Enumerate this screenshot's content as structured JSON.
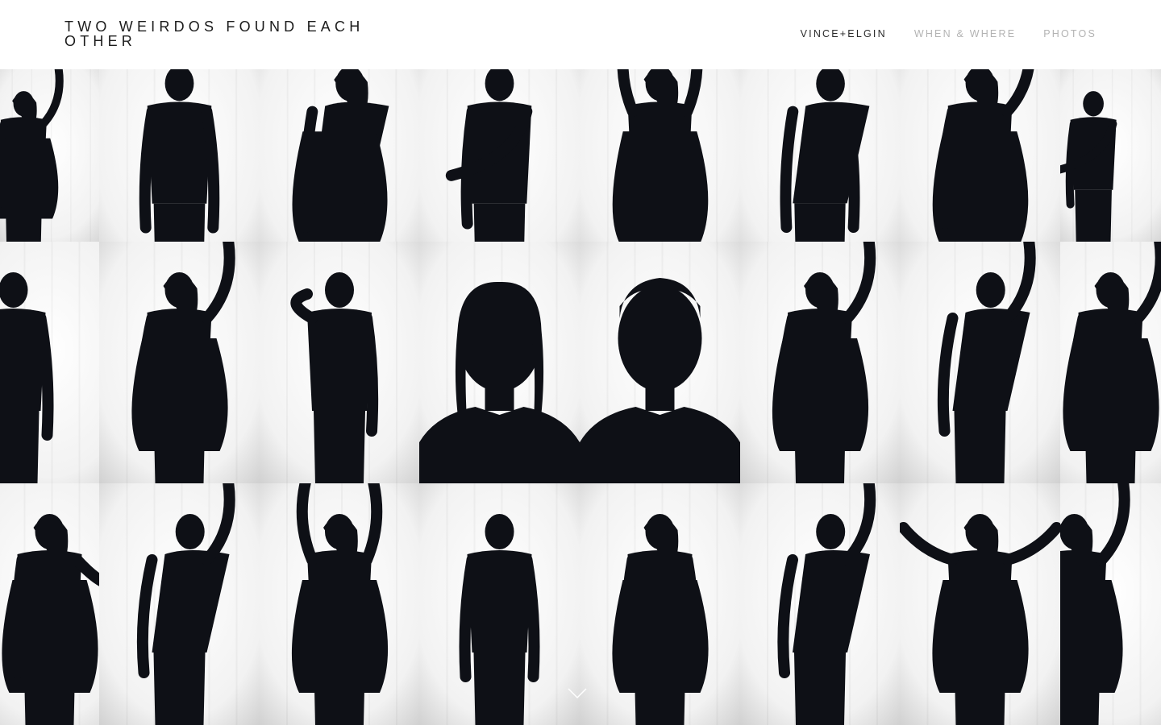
{
  "site": {
    "title": "TWO WEIRDOS FOUND EACH OTHER"
  },
  "nav": {
    "items": [
      {
        "label": "VINCE+ELGIN",
        "active": true
      },
      {
        "label": "WHEN & WHERE",
        "active": false
      },
      {
        "label": "PHOTOS",
        "active": false
      }
    ]
  },
  "gallery": {
    "rows": 3,
    "columns": 8,
    "tiles": [
      {
        "row": 1,
        "col": 1,
        "subject": "woman",
        "pose": "arm-up-turned"
      },
      {
        "row": 1,
        "col": 2,
        "subject": "man",
        "pose": "standing-head-down"
      },
      {
        "row": 1,
        "col": 3,
        "subject": "woman",
        "pose": "leaning-cardigan"
      },
      {
        "row": 1,
        "col": 4,
        "subject": "man",
        "pose": "arm-extended-profile"
      },
      {
        "row": 1,
        "col": 5,
        "subject": "woman",
        "pose": "arms-raised"
      },
      {
        "row": 1,
        "col": 6,
        "subject": "man",
        "pose": "bending-side"
      },
      {
        "row": 1,
        "col": 7,
        "subject": "woman",
        "pose": "hand-on-head"
      },
      {
        "row": 1,
        "col": 8,
        "subject": "man",
        "pose": "arm-across"
      },
      {
        "row": 2,
        "col": 1,
        "subject": "man",
        "pose": "head-down-cropped"
      },
      {
        "row": 2,
        "col": 2,
        "subject": "woman",
        "pose": "arm-up-reaching"
      },
      {
        "row": 2,
        "col": 3,
        "subject": "man",
        "pose": "hand-to-face"
      },
      {
        "row": 2,
        "col": 4,
        "subject": "woman",
        "pose": "portrait"
      },
      {
        "row": 2,
        "col": 5,
        "subject": "man",
        "pose": "portrait"
      },
      {
        "row": 2,
        "col": 6,
        "subject": "woman",
        "pose": "arm-over-head"
      },
      {
        "row": 2,
        "col": 7,
        "subject": "man",
        "pose": "leaning-arm-up"
      },
      {
        "row": 2,
        "col": 8,
        "subject": "woman",
        "pose": "cardigan-over-head"
      },
      {
        "row": 3,
        "col": 1,
        "subject": "woman",
        "pose": "hand-raised"
      },
      {
        "row": 3,
        "col": 2,
        "subject": "man",
        "pose": "arm-up-bending"
      },
      {
        "row": 3,
        "col": 3,
        "subject": "woman",
        "pose": "both-arms-up"
      },
      {
        "row": 3,
        "col": 4,
        "subject": "man",
        "pose": "standing-front"
      },
      {
        "row": 3,
        "col": 5,
        "subject": "woman",
        "pose": "standing-front"
      },
      {
        "row": 3,
        "col": 6,
        "subject": "man",
        "pose": "leaning-arm-up"
      },
      {
        "row": 3,
        "col": 7,
        "subject": "woman",
        "pose": "arms-out"
      },
      {
        "row": 3,
        "col": 8,
        "subject": "woman",
        "pose": "hand-on-head-cropped"
      }
    ]
  },
  "scroll_indicator": {
    "icon": "chevron-down-icon"
  },
  "colors": {
    "title": "#1c1c1c",
    "nav_active": "#2a2a2a",
    "nav_inactive": "#b3b3b3",
    "silhouette": "#0e1016",
    "backdrop": "#f2f2f2"
  }
}
